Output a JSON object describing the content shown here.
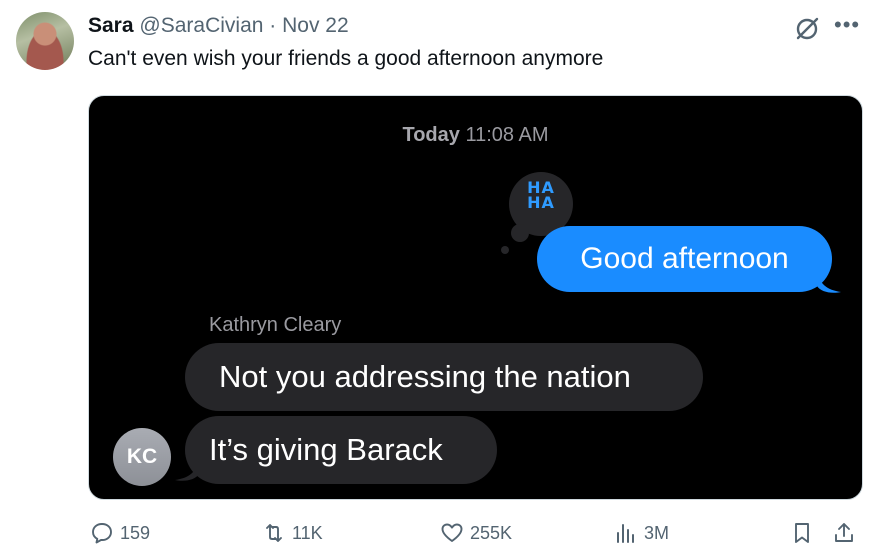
{
  "tweet": {
    "author_name": "Sara",
    "author_handle": "@SaraCivian",
    "separator": "·",
    "date": "Nov 22",
    "text": "Can't even wish your friends a good afternoon anymore",
    "more_icon": "more-horizontal-icon",
    "grok_icon": "grok-icon"
  },
  "screenshot": {
    "timestamp_day": "Today",
    "timestamp_time": "11:08 AM",
    "reaction_text_line1": "HA",
    "reaction_text_line2": "HA",
    "sent_message": "Good afternoon",
    "sender_name": "Kathryn Cleary",
    "received_messages": [
      "Not you addressing the nation",
      "It’s giving Barack"
    ],
    "sender_initials": "KC",
    "colors": {
      "sent_bubble": "#1a8cff",
      "received_bubble": "#262629",
      "reaction": "#2f9bff"
    }
  },
  "actions": {
    "replies": "159",
    "reposts": "11K",
    "likes": "255K",
    "views": "3M",
    "icons": [
      "reply-icon",
      "repost-icon",
      "like-icon",
      "views-icon",
      "bookmark-icon",
      "share-icon"
    ]
  }
}
